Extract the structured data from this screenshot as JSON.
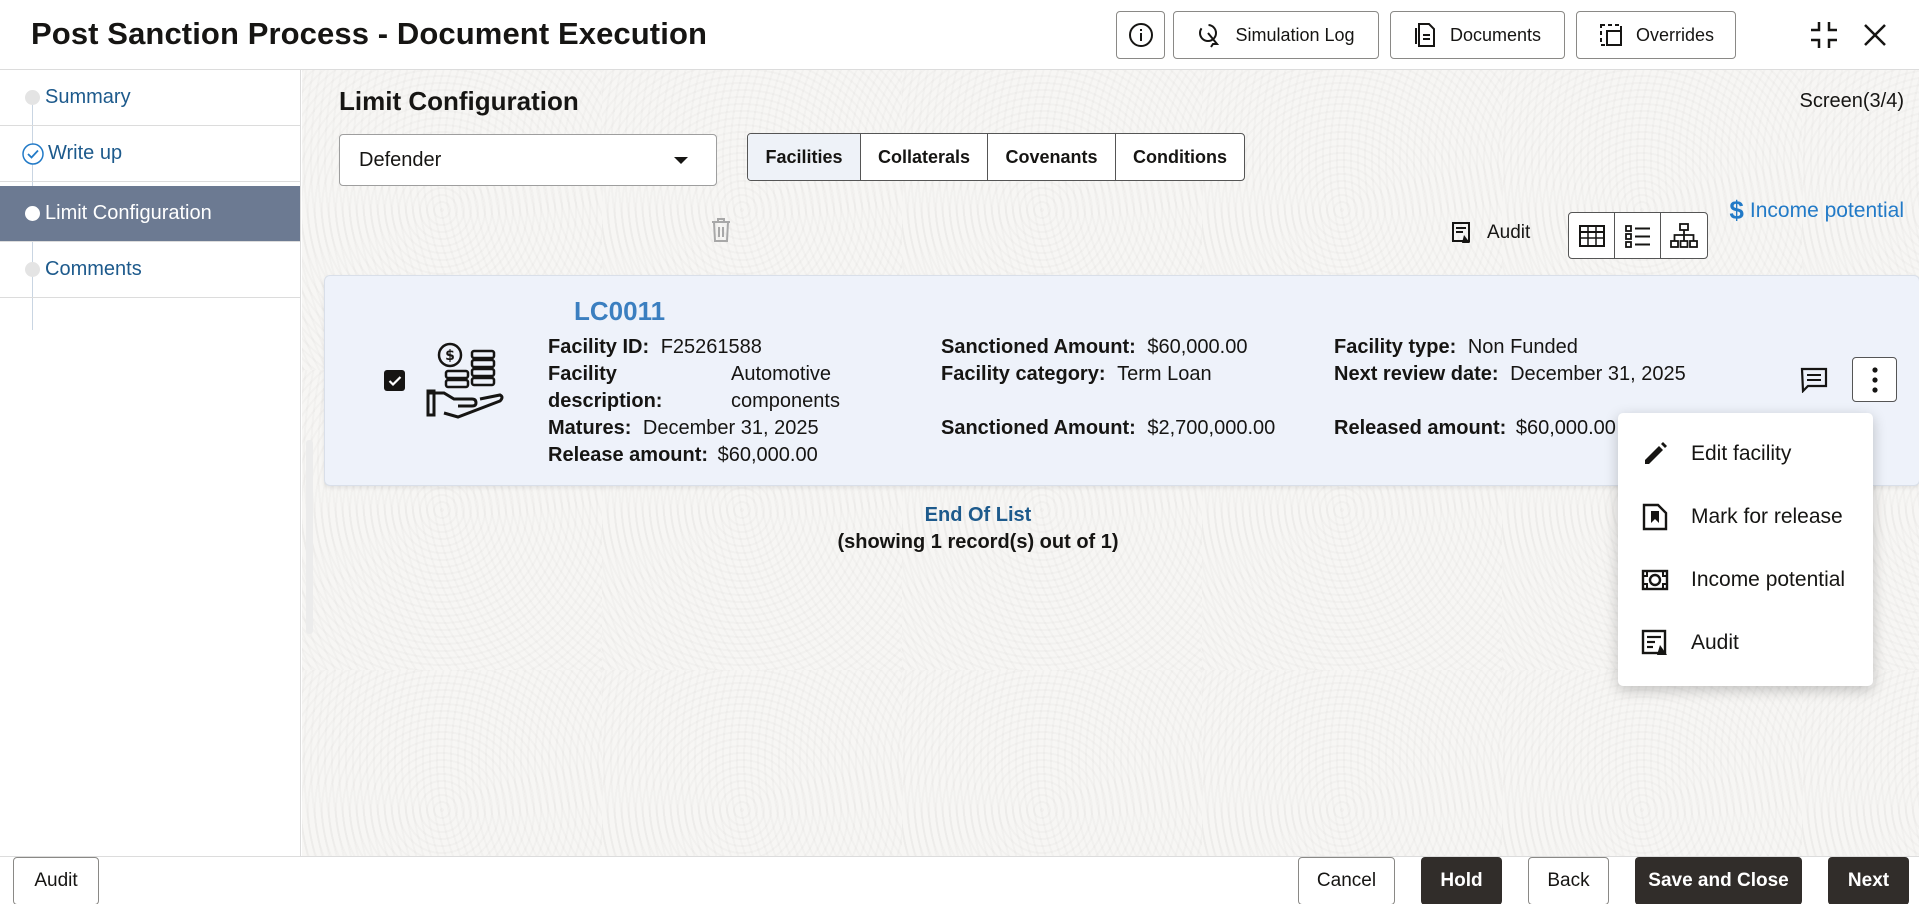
{
  "header": {
    "title": "Post Sanction Process - Document Execution",
    "buttons": {
      "simulation_log": "Simulation Log",
      "documents": "Documents",
      "overrides": "Overrides"
    }
  },
  "sidebar": {
    "steps": [
      {
        "label": "Summary",
        "state": "pending"
      },
      {
        "label": "Write up",
        "state": "done"
      },
      {
        "label": "Limit Configuration",
        "state": "active"
      },
      {
        "label": "Comments",
        "state": "pending"
      }
    ]
  },
  "main": {
    "title": "Limit Configuration",
    "screen": "Screen(3/4)",
    "customer_select": "Defender",
    "tabs": [
      "Facilities",
      "Collaterals",
      "Covenants",
      "Conditions"
    ],
    "selected_tab": "Facilities",
    "income_potential_link": "Income potential",
    "audit_label": "Audit",
    "card": {
      "title": "LC0011",
      "facility_id_label": "Facility ID:",
      "facility_id": "F25261588",
      "facility_description_label_1": "Facility",
      "facility_description_label_2": "description:",
      "facility_description_1": "Automotive",
      "facility_description_2": "components",
      "matures_label": "Matures:",
      "matures": "December 31, 2025",
      "release_amount_label": "Release amount:",
      "release_amount": "$60,000.00",
      "sanctioned_amount_label_1": "Sanctioned Amount:",
      "sanctioned_amount_1": "$60,000.00",
      "facility_category_label": "Facility category:",
      "facility_category": "Term Loan",
      "sanctioned_amount_label_2": "Sanctioned Amount:",
      "sanctioned_amount_2": "$2,700,000.00",
      "facility_type_label": "Facility type:",
      "facility_type": "Non Funded",
      "next_review_label": "Next review date:",
      "next_review": "December 31, 2025",
      "released_amount_label": "Released amount:",
      "released_amount": "$60,000.00"
    },
    "end_of_list": "End Of List",
    "record_count": "(showing 1 record(s) out of 1)"
  },
  "menu": {
    "items": [
      {
        "label": "Edit facility",
        "icon": "pencil-icon"
      },
      {
        "label": "Mark for release",
        "icon": "flag-icon"
      },
      {
        "label": "Income potential",
        "icon": "money-icon"
      },
      {
        "label": "Audit",
        "icon": "audit-icon"
      }
    ]
  },
  "footer": {
    "audit": "Audit",
    "cancel": "Cancel",
    "hold": "Hold",
    "back": "Back",
    "save_close": "Save and Close",
    "next": "Next"
  },
  "colors": {
    "accent_link": "#227ac7",
    "active_step": "#6c7a92",
    "dark_button": "#312d2a"
  }
}
